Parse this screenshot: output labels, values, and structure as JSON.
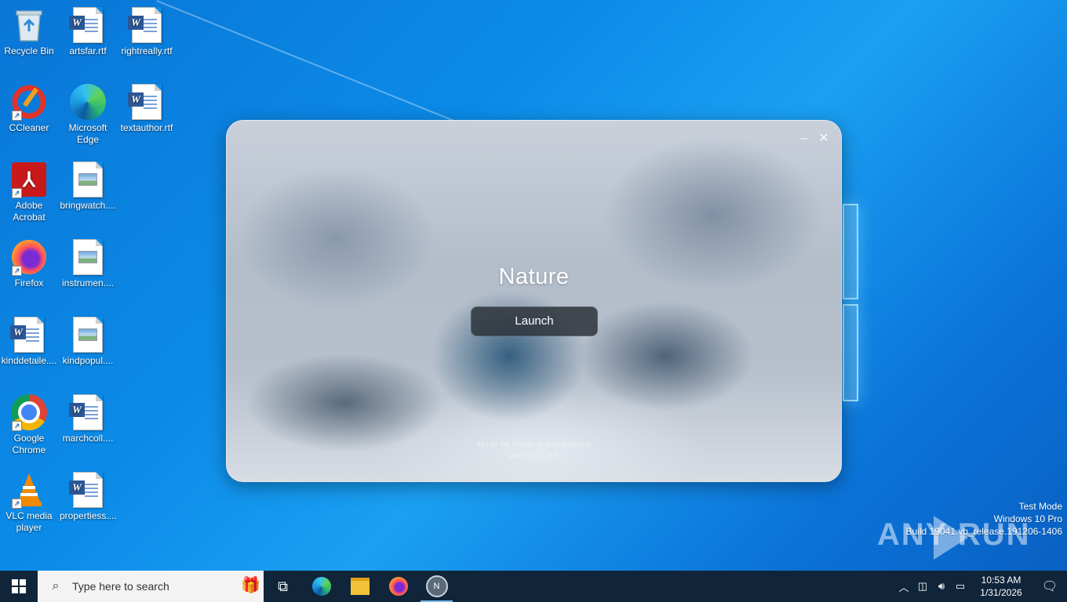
{
  "desktop": {
    "icons": [
      {
        "label": "Recycle Bin",
        "icon": "recycle-bin-icon"
      },
      {
        "label": "artsfar.rtf",
        "icon": "word-document-icon"
      },
      {
        "label": "rightreally.rtf",
        "icon": "word-document-icon"
      },
      {
        "label": "CCleaner",
        "icon": "ccleaner-icon"
      },
      {
        "label": "Microsoft Edge",
        "icon": "edge-icon"
      },
      {
        "label": "textauthor.rtf",
        "icon": "word-document-icon"
      },
      {
        "label": "Adobe Acrobat",
        "icon": "acrobat-icon"
      },
      {
        "label": "bringwatch....",
        "icon": "image-file-icon"
      },
      {
        "label": "Firefox",
        "icon": "firefox-icon"
      },
      {
        "label": "instrumen....",
        "icon": "image-file-icon"
      },
      {
        "label": "kinddetaile....",
        "icon": "word-document-icon"
      },
      {
        "label": "kindpopul....",
        "icon": "image-file-icon"
      },
      {
        "label": "Google Chrome",
        "icon": "chrome-icon"
      },
      {
        "label": "marchcoll....",
        "icon": "word-document-icon"
      },
      {
        "label": "VLC media player",
        "icon": "vlc-icon"
      },
      {
        "label": "propertiess....",
        "icon": "word-document-icon"
      }
    ]
  },
  "app_window": {
    "title": "Nature",
    "launch_label": "Launch",
    "credits_line1": "Made by Neoki & Surukotonai",
    "credits_line2": "Version 1.0.4",
    "minimize_glyph": "–",
    "close_glyph": "✕"
  },
  "watermark": {
    "line1": "Test Mode",
    "line2": "Windows 10 Pro",
    "line3": "Build 19041.vb_release.191206-1406",
    "brand": "ANY RUN"
  },
  "taskbar": {
    "search_placeholder": "Type here to search",
    "time": "10:53 AM",
    "date": "1/31/2026",
    "pinned": [
      "task-view-icon",
      "edge-icon",
      "file-explorer-icon",
      "firefox-icon",
      "nature-app-icon"
    ]
  }
}
